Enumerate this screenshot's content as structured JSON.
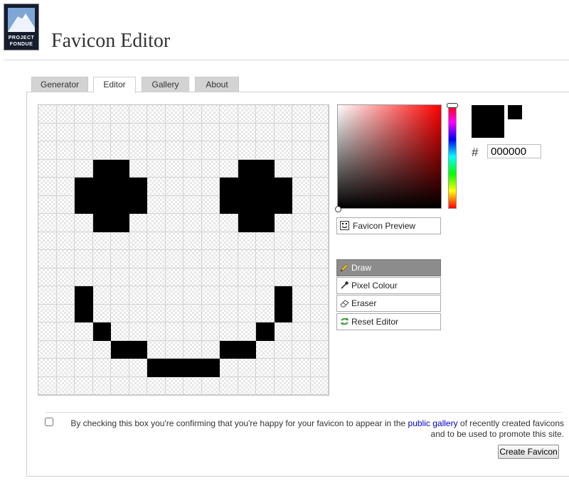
{
  "logo": {
    "line1": "PROJECT",
    "line2": "FONDUE"
  },
  "page_title": "Favicon Editor",
  "tabs": [
    {
      "label": "Generator",
      "active": false
    },
    {
      "label": "Editor",
      "active": true
    },
    {
      "label": "Gallery",
      "active": false
    },
    {
      "label": "About",
      "active": false
    }
  ],
  "canvas": {
    "cols": 16,
    "rows": 16,
    "pixels_on": [
      [
        3,
        3
      ],
      [
        4,
        3
      ],
      [
        11,
        3
      ],
      [
        12,
        3
      ],
      [
        2,
        4
      ],
      [
        3,
        4
      ],
      [
        4,
        4
      ],
      [
        5,
        4
      ],
      [
        10,
        4
      ],
      [
        11,
        4
      ],
      [
        12,
        4
      ],
      [
        13,
        4
      ],
      [
        2,
        5
      ],
      [
        3,
        5
      ],
      [
        4,
        5
      ],
      [
        5,
        5
      ],
      [
        10,
        5
      ],
      [
        11,
        5
      ],
      [
        12,
        5
      ],
      [
        13,
        5
      ],
      [
        3,
        6
      ],
      [
        4,
        6
      ],
      [
        11,
        6
      ],
      [
        12,
        6
      ],
      [
        2,
        10
      ],
      [
        13,
        10
      ],
      [
        2,
        11
      ],
      [
        13,
        11
      ],
      [
        3,
        12
      ],
      [
        12,
        12
      ],
      [
        4,
        13
      ],
      [
        5,
        13
      ],
      [
        10,
        13
      ],
      [
        11,
        13
      ],
      [
        6,
        14
      ],
      [
        7,
        14
      ],
      [
        8,
        14
      ],
      [
        9,
        14
      ]
    ]
  },
  "color": {
    "hash": "#",
    "hex": "000000",
    "current": "#000000"
  },
  "preview_button": "Favicon Preview",
  "tools": [
    {
      "label": "Draw",
      "icon": "pencil-icon",
      "selected": true
    },
    {
      "label": "Pixel Colour",
      "icon": "eyedropper-icon",
      "selected": false
    },
    {
      "label": "Eraser",
      "icon": "eraser-icon",
      "selected": false
    },
    {
      "label": "Reset Editor",
      "icon": "reset-icon",
      "selected": false
    }
  ],
  "consent": {
    "before": "By checking this box you're confirming that you're happy for your favicon to appear in the ",
    "link": "public gallery",
    "after": " of recently created favicons and to be used to promote this site."
  },
  "create_button": "Create Favicon"
}
